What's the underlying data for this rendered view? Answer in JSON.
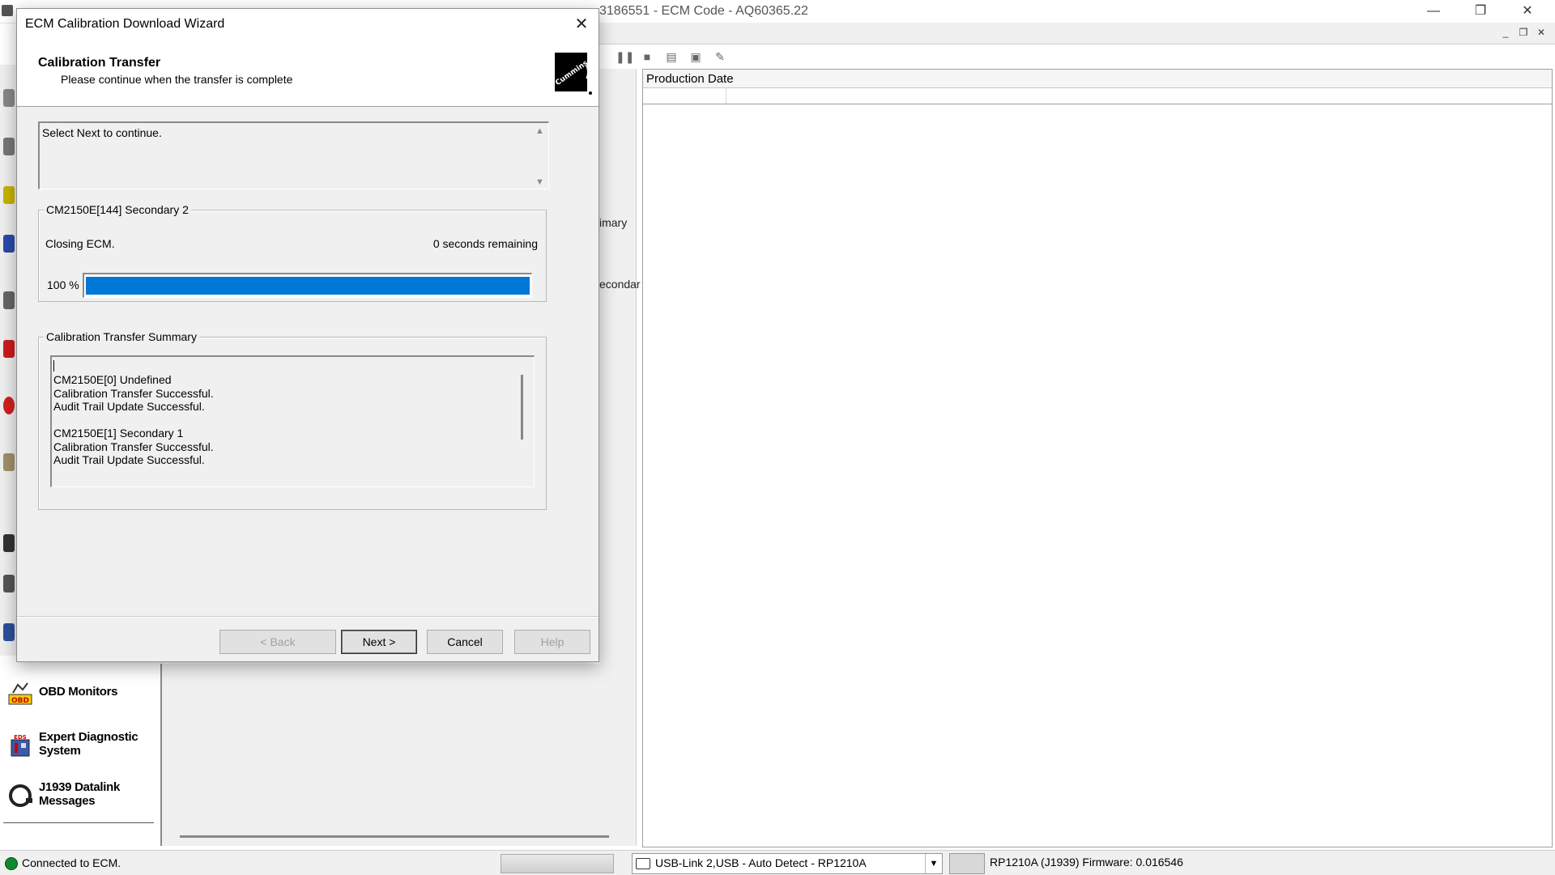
{
  "main_window": {
    "title": "3186551 - ECM Code - AQ60365.22",
    "controls": {
      "minimize": "—",
      "maximize": "❐",
      "close": "✕"
    },
    "mdi_controls": {
      "minimize": "_",
      "restore": "❐",
      "close": "✕"
    }
  },
  "toolbar": {
    "icons": [
      "pause-icon",
      "stop-icon",
      "export-icon",
      "print-preview-icon",
      "notes-icon"
    ]
  },
  "background_panel": {
    "label_primary": "imary",
    "label_secondary": "econdar"
  },
  "grid": {
    "columns": [
      "Production Date"
    ]
  },
  "sidebar": {
    "items": [
      {
        "label": "OBD Monitors",
        "icon": "obd-monitors-icon"
      },
      {
        "label": "Expert Diagnostic System",
        "icon": "expert-diagnostic-icon"
      },
      {
        "label": "J1939 Datalink Messages",
        "icon": "j1939-datalink-icon"
      }
    ]
  },
  "statusbar": {
    "status": "Connected to ECM.",
    "adapter": "USB-Link 2,USB - Auto Detect - RP1210A",
    "firmware": "RP1210A (J1939)  Firmware: 0.016546",
    "status_color": "#0e8a2e"
  },
  "dialog": {
    "title": "ECM Calibration Download Wizard",
    "heading": "Calibration Transfer",
    "subheading": "Please continue when the transfer is complete",
    "logo_text": "Cummins",
    "info_message": "Select Next to continue.",
    "progress_group": {
      "title": "CM2150E[144] Secondary 2",
      "status": "Closing ECM.",
      "remaining": "0 seconds remaining",
      "percent_label": "100 %",
      "percent": 100,
      "bar_color": "#0078d7"
    },
    "summary_group": {
      "title": "Calibration Transfer Summary",
      "lines": [
        "CM2150E[0] Undefined",
        "Calibration Transfer Successful.",
        "Audit Trail Update Successful.",
        "",
        "CM2150E[1] Secondary 1",
        "Calibration Transfer Successful.",
        "Audit Trail Update Successful."
      ]
    },
    "buttons": {
      "back": "< Back",
      "next": "Next >",
      "cancel": "Cancel",
      "help": "Help"
    }
  }
}
